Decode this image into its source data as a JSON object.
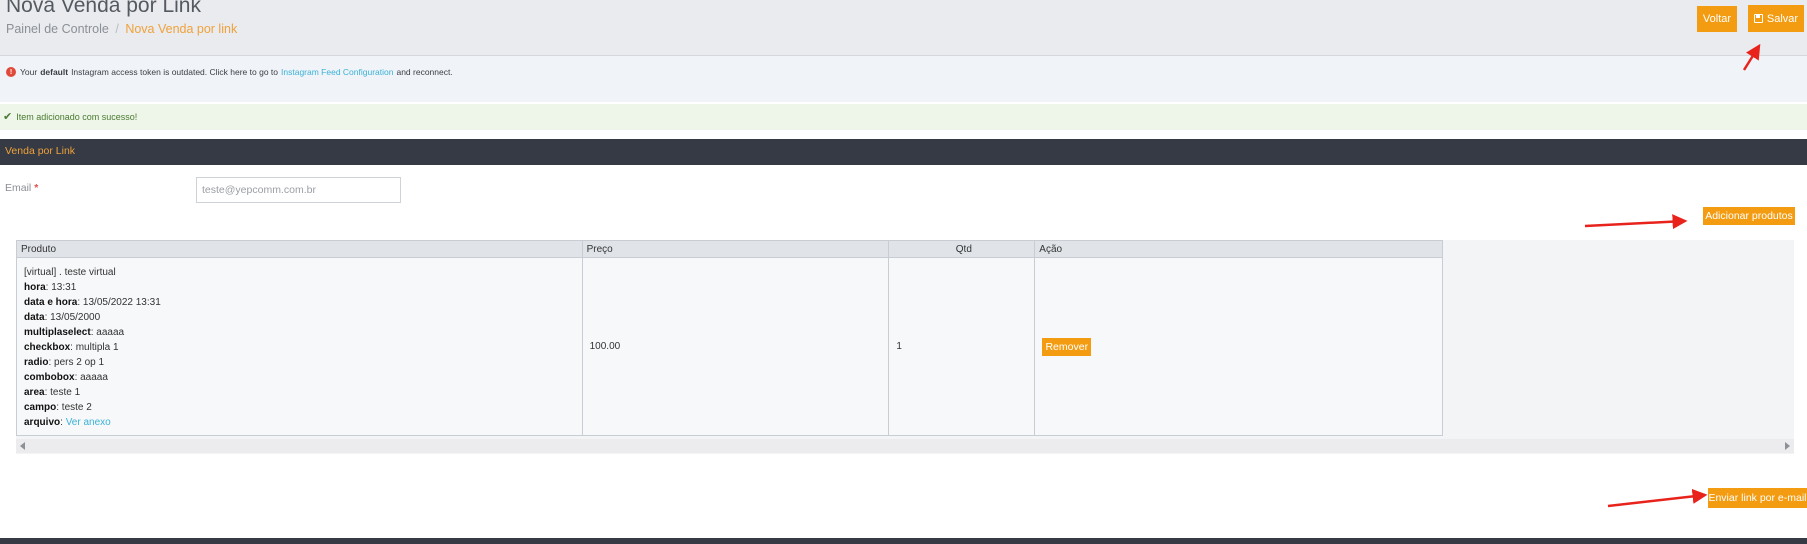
{
  "header": {
    "title": "Nova Venda por Link",
    "breadcrumb": {
      "home": "Painel de Controle",
      "separator": "/",
      "current": "Nova Venda por link"
    },
    "buttons": {
      "back": "Voltar",
      "save": "Salvar"
    }
  },
  "instagram_alert": {
    "text_before": "Your",
    "bold": "default",
    "text_middle": "Instagram access token is outdated. Click here to go to",
    "link": "Instagram Feed Configuration",
    "text_after": "and reconnect."
  },
  "success_alert": {
    "text": "Item adicionado com sucesso!"
  },
  "panel": {
    "title": "Venda por Link"
  },
  "form": {
    "email_label": "Email",
    "required_mark": "*",
    "email_placeholder": "teste@yepcomm.com.br"
  },
  "buttons": {
    "add_products": "Adicionar produtos",
    "remove": "Remover",
    "send_link": "Enviar link por e-mail"
  },
  "table": {
    "headers": {
      "product": "Produto",
      "price": "Preço",
      "qty": "Qtd",
      "action": "Ação"
    },
    "rows": [
      {
        "product_name": "[virtual] . teste virtual",
        "attributes": [
          {
            "key": "hora",
            "value": "13:31"
          },
          {
            "key": "data e hora",
            "value": "13/05/2022 13:31"
          },
          {
            "key": "data",
            "value": "13/05/2000"
          },
          {
            "key": "multiplaselect",
            "value": "aaaaa"
          },
          {
            "key": "checkbox",
            "value": "multipla 1"
          },
          {
            "key": "radio",
            "value": "pers 2 op 1"
          },
          {
            "key": "combobox",
            "value": "aaaaa"
          },
          {
            "key": "area",
            "value": "teste 1"
          },
          {
            "key": "campo",
            "value": "teste 2"
          },
          {
            "key": "arquivo",
            "value": "Ver anexo"
          }
        ],
        "price": "100.00",
        "qty": "1"
      }
    ]
  },
  "colors": {
    "accent": "#f39c12",
    "link": "#3bb2d6",
    "panel_header": "#353a44",
    "annotation_arrow": "#e8231c"
  },
  "icons": {
    "error": "exclamation-circle-icon",
    "success": "check-icon",
    "save": "floppy-disk-icon",
    "scroll_left": "triangle-left-icon",
    "scroll_right": "triangle-right-icon"
  }
}
